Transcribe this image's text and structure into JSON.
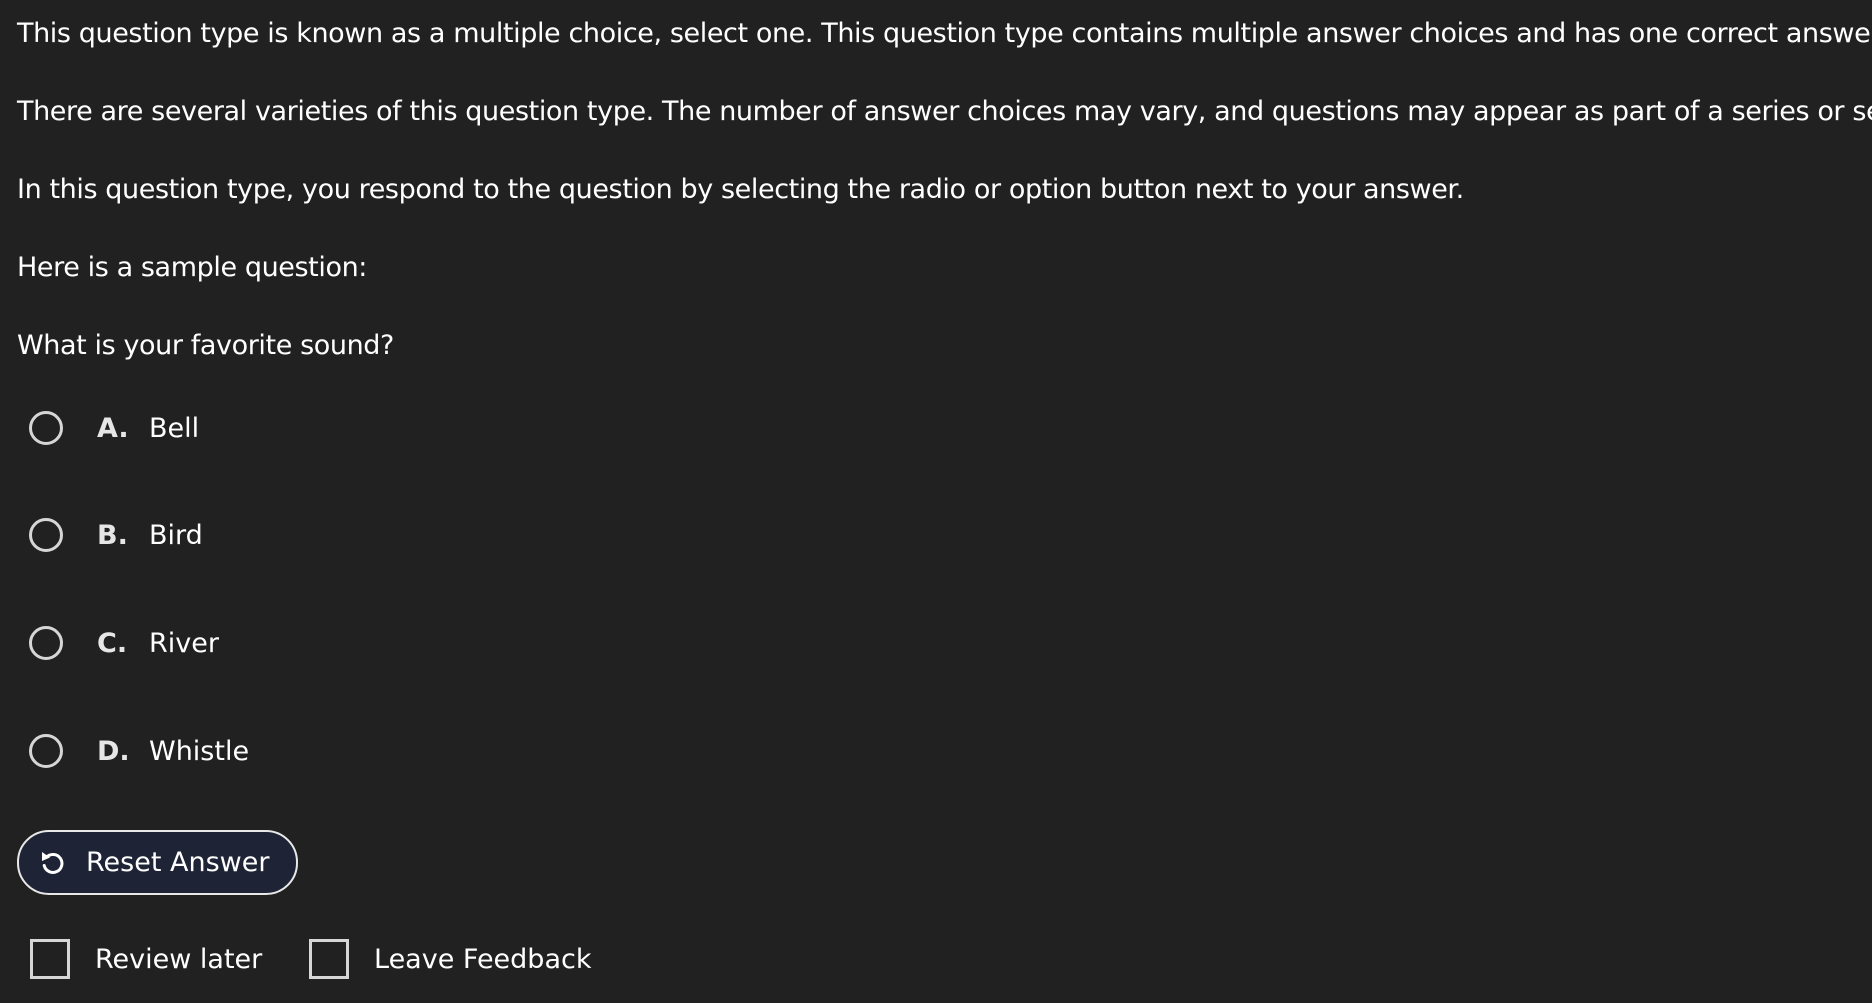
{
  "intro": {
    "line1": "This question type is known as a multiple choice, select one. This question type contains multiple answer choices and has one correct answer.",
    "line2": "There are several varieties of this question type. The number of answer choices may vary, and questions may appear as part of a series or set.",
    "line3": "In this question type, you respond to the question by selecting the radio or option button next to your answer.",
    "line4": "Here is a sample question:"
  },
  "question": {
    "text": "What is your favorite sound?",
    "options": [
      {
        "letter": "A.",
        "label": "Bell"
      },
      {
        "letter": "B.",
        "label": "Bird"
      },
      {
        "letter": "C.",
        "label": "River"
      },
      {
        "letter": "D.",
        "label": "Whistle"
      }
    ]
  },
  "actions": {
    "reset_label": "Reset Answer",
    "reset_icon": "reset-icon",
    "review_later_label": "Review later",
    "leave_feedback_label": "Leave Feedback"
  },
  "colors": {
    "background": "#212121",
    "text": "#ffffff",
    "button_fill": "#1e2436",
    "control_border": "#d6d6d6"
  }
}
